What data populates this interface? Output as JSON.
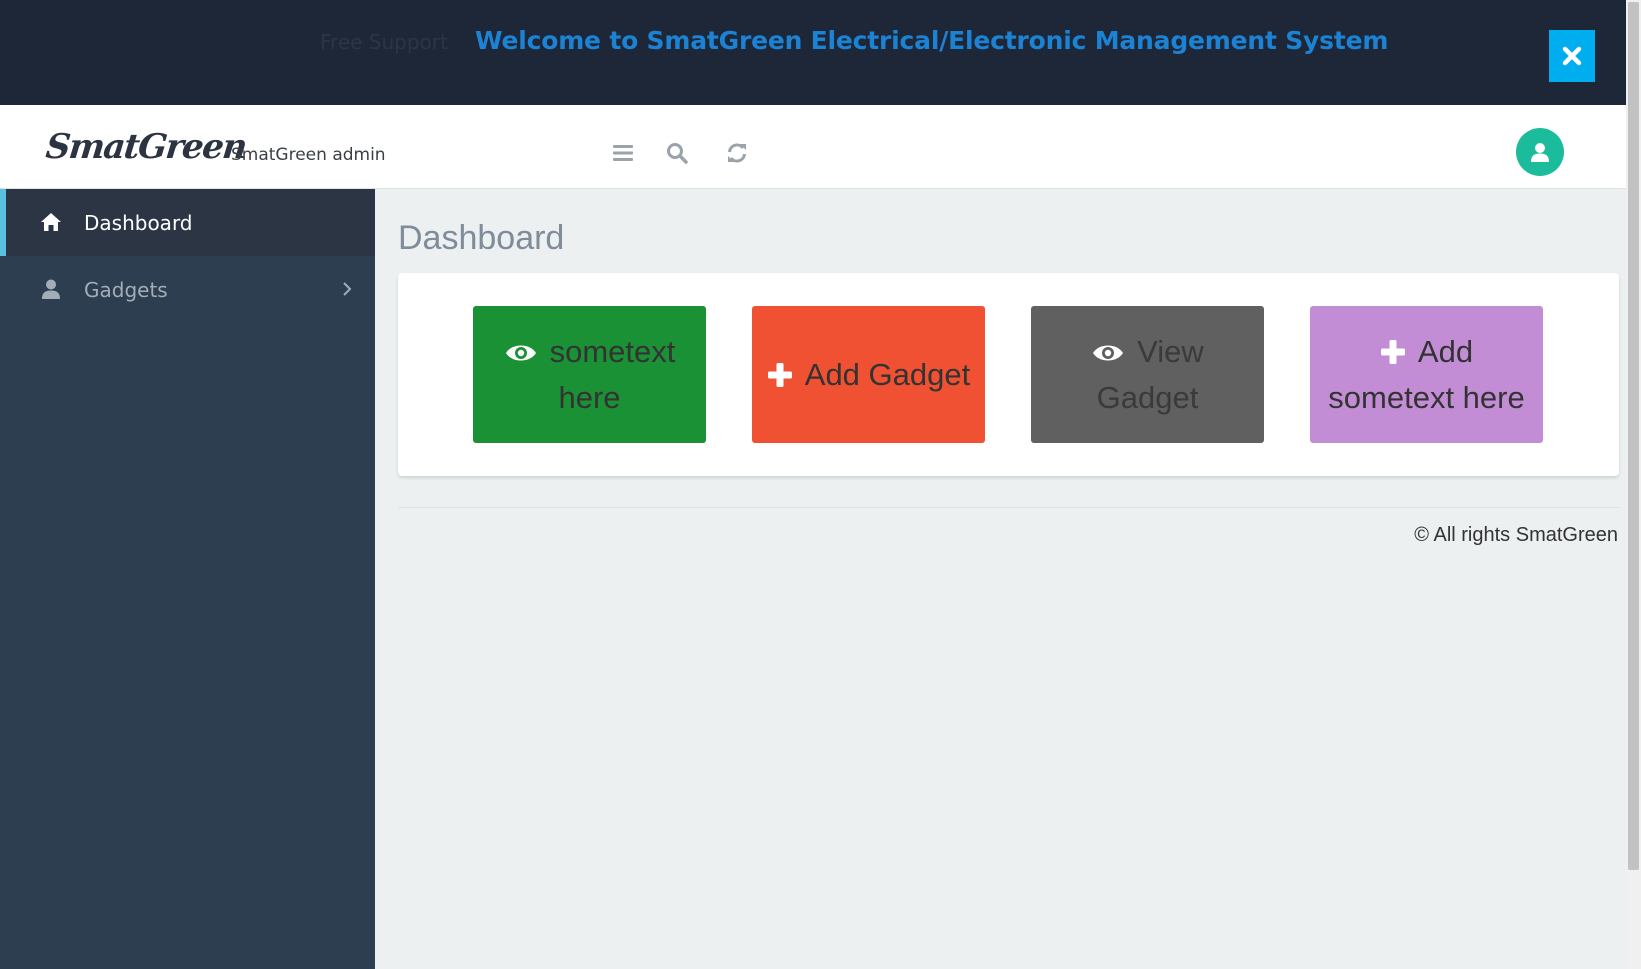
{
  "banner": {
    "support_text": "Free Support",
    "welcome_text": "Welcome to SmatGreen Electrical/Electronic Management System",
    "close_icon": "close-icon",
    "close_color": "#00aeef"
  },
  "header": {
    "logo_text": "SmatGreen",
    "admin_label": "SmatGreen admin",
    "icons": [
      "menu-icon",
      "search-icon",
      "refresh-icon"
    ],
    "avatar_icon": "user-icon",
    "avatar_color": "#1abc9c"
  },
  "sidebar": {
    "items": [
      {
        "label": "Dashboard",
        "icon": "home-icon",
        "active": true
      },
      {
        "label": "Gadgets",
        "icon": "user-icon",
        "active": false,
        "has_children": true
      }
    ]
  },
  "main": {
    "title": "Dashboard",
    "tiles": [
      {
        "label": "sometext here",
        "icon": "eye-icon",
        "color": "#1b9135"
      },
      {
        "label": "Add Gadget",
        "icon": "plus-icon",
        "color": "#f05133"
      },
      {
        "label": "View Gadget",
        "icon": "eye-icon",
        "color": "#606060"
      },
      {
        "label": "Add sometext here",
        "icon": "plus-icon",
        "color": "#c38dd6"
      }
    ]
  },
  "footer": {
    "text": "© All rights SmatGreen"
  }
}
